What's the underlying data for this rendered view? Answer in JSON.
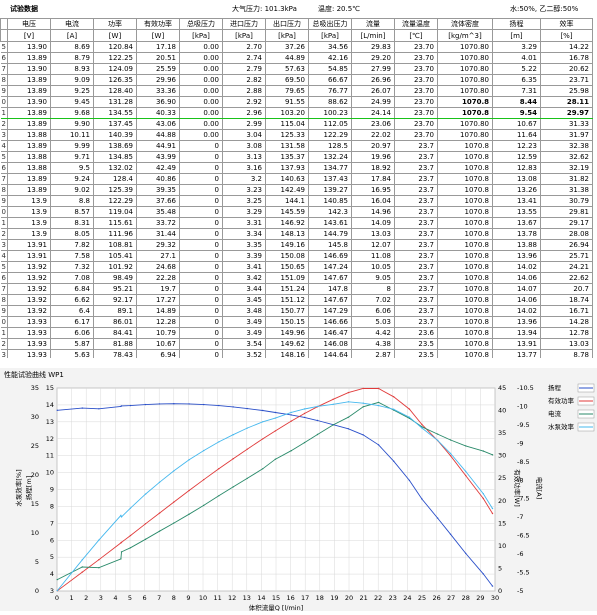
{
  "header": {
    "title": "试验数据",
    "pressure_label": "大气压力: 101.3kPa",
    "temp_label": "温度: 20.5℃",
    "right_label": "水:50%, 乙二醇:50%"
  },
  "table": {
    "headers": [
      "电压",
      "电流",
      "功率",
      "有效功率",
      "总吸压力",
      "进口压力",
      "出口压力",
      "总吸出压力",
      "流量",
      "流量温度",
      "流体密度",
      "扬程",
      "效率"
    ],
    "units": [
      "[V]",
      "[A]",
      "[W]",
      "[W]",
      "[kPa]",
      "[kPa]",
      "[kPa]",
      "[kPa]",
      "[L/min]",
      "[℃]",
      "[kg/m^3]",
      "[m]",
      "[%]"
    ],
    "index": [
      "5",
      "6",
      "7",
      "8",
      "9",
      "0",
      "1",
      "2",
      "3",
      "4",
      "5",
      "6",
      "7",
      "8",
      "9",
      "0",
      "1",
      "2",
      "3",
      "4",
      "5",
      "6",
      "7",
      "8",
      "9",
      "0",
      "1",
      "2",
      "3",
      "4",
      "5",
      "6",
      "7",
      "8",
      "9"
    ],
    "rows": [
      [
        "13.90",
        "8.69",
        "120.84",
        "17.18",
        "0.00",
        "2.70",
        "37.26",
        "34.56",
        "29.83",
        "23.70",
        "1070.80",
        "3.29",
        "14.22"
      ],
      [
        "13.89",
        "8.79",
        "122.25",
        "20.51",
        "0.00",
        "2.74",
        "44.89",
        "42.16",
        "29.20",
        "23.70",
        "1070.80",
        "4.01",
        "16.78"
      ],
      [
        "13.90",
        "8.93",
        "124.09",
        "25.59",
        "0.00",
        "2.79",
        "57.63",
        "54.85",
        "27.99",
        "23.70",
        "1070.80",
        "5.22",
        "20.62"
      ],
      [
        "13.89",
        "9.09",
        "126.35",
        "29.96",
        "0.00",
        "2.82",
        "69.50",
        "66.67",
        "26.96",
        "23.70",
        "1070.80",
        "6.35",
        "23.71"
      ],
      [
        "13.89",
        "9.25",
        "128.40",
        "33.36",
        "0.00",
        "2.88",
        "79.65",
        "76.77",
        "26.07",
        "23.70",
        "1070.80",
        "7.31",
        "25.98"
      ],
      [
        "13.90",
        "9.45",
        "131.28",
        "36.90",
        "0.00",
        "2.92",
        "91.55",
        "88.62",
        "24.99",
        "23.70",
        "1070.8",
        "8.44",
        "28.11"
      ],
      [
        "13.89",
        "9.68",
        "134.55",
        "40.33",
        "0.00",
        "2.96",
        "103.20",
        "100.23",
        "24.14",
        "23.70",
        "1070.8",
        "9.54",
        "29.97"
      ],
      [
        "13.89",
        "9.90",
        "137.45",
        "43.06",
        "0.00",
        "2.99",
        "115.04",
        "112.05",
        "23.06",
        "23.70",
        "1070.80",
        "10.67",
        "31.33"
      ],
      [
        "13.88",
        "10.11",
        "140.39",
        "44.88",
        "0.00",
        "3.04",
        "125.33",
        "122.29",
        "22.02",
        "23.70",
        "1070.80",
        "11.64",
        "31.97"
      ],
      [
        "13.89",
        "9.99",
        "138.69",
        "44.91",
        "0",
        "3.08",
        "131.58",
        "128.5",
        "20.97",
        "23.7",
        "1070.8",
        "12.23",
        "32.38"
      ],
      [
        "13.88",
        "9.71",
        "134.85",
        "43.99",
        "0",
        "3.13",
        "135.37",
        "132.24",
        "19.96",
        "23.7",
        "1070.8",
        "12.59",
        "32.62"
      ],
      [
        "13.88",
        "9.5",
        "132.02",
        "42.49",
        "0",
        "3.16",
        "137.93",
        "134.77",
        "18.92",
        "23.7",
        "1070.8",
        "12.83",
        "32.19"
      ],
      [
        "13.89",
        "9.24",
        "128.4",
        "40.86",
        "0",
        "3.2",
        "140.63",
        "137.43",
        "17.84",
        "23.7",
        "1070.8",
        "13.08",
        "31.82"
      ],
      [
        "13.89",
        "9.02",
        "125.39",
        "39.35",
        "0",
        "3.23",
        "142.49",
        "139.27",
        "16.95",
        "23.7",
        "1070.8",
        "13.26",
        "31.38"
      ],
      [
        "13.9",
        "8.8",
        "122.29",
        "37.66",
        "0",
        "3.25",
        "144.1",
        "140.85",
        "16.04",
        "23.7",
        "1070.8",
        "13.41",
        "30.79"
      ],
      [
        "13.9",
        "8.57",
        "119.04",
        "35.48",
        "0",
        "3.29",
        "145.59",
        "142.3",
        "14.96",
        "23.7",
        "1070.8",
        "13.55",
        "29.81"
      ],
      [
        "13.9",
        "8.31",
        "115.61",
        "33.72",
        "0",
        "3.31",
        "146.92",
        "143.61",
        "14.09",
        "23.7",
        "1070.8",
        "13.67",
        "29.17"
      ],
      [
        "13.9",
        "8.05",
        "111.96",
        "31.44",
        "0",
        "3.34",
        "148.13",
        "144.79",
        "13.03",
        "23.7",
        "1070.8",
        "13.78",
        "28.08"
      ],
      [
        "13.91",
        "7.82",
        "108.81",
        "29.32",
        "0",
        "3.35",
        "149.16",
        "145.8",
        "12.07",
        "23.7",
        "1070.8",
        "13.88",
        "26.94"
      ],
      [
        "13.91",
        "7.58",
        "105.41",
        "27.1",
        "0",
        "3.39",
        "150.08",
        "146.69",
        "11.08",
        "23.7",
        "1070.8",
        "13.96",
        "25.71"
      ],
      [
        "13.92",
        "7.32",
        "101.92",
        "24.68",
        "0",
        "3.41",
        "150.65",
        "147.24",
        "10.05",
        "23.7",
        "1070.8",
        "14.02",
        "24.21"
      ],
      [
        "13.92",
        "7.08",
        "98.49",
        "22.28",
        "0",
        "3.42",
        "151.09",
        "147.67",
        "9.05",
        "23.7",
        "1070.8",
        "14.06",
        "22.62"
      ],
      [
        "13.92",
        "6.84",
        "95.21",
        "19.7",
        "0",
        "3.44",
        "151.24",
        "147.8",
        "8",
        "23.7",
        "1070.8",
        "14.07",
        "20.7"
      ],
      [
        "13.92",
        "6.62",
        "92.17",
        "17.27",
        "0",
        "3.45",
        "151.12",
        "147.67",
        "7.02",
        "23.7",
        "1070.8",
        "14.06",
        "18.74"
      ],
      [
        "13.92",
        "6.4",
        "89.1",
        "14.89",
        "0",
        "3.48",
        "150.77",
        "147.29",
        "6.06",
        "23.7",
        "1070.8",
        "14.02",
        "16.71"
      ],
      [
        "13.93",
        "6.17",
        "86.01",
        "12.28",
        "0",
        "3.49",
        "150.15",
        "146.66",
        "5.03",
        "23.7",
        "1070.8",
        "13.96",
        "14.28"
      ],
      [
        "13.93",
        "6.06",
        "84.41",
        "10.79",
        "0",
        "3.49",
        "149.96",
        "146.47",
        "4.42",
        "23.6",
        "1070.8",
        "13.94",
        "12.78"
      ],
      [
        "13.93",
        "5.87",
        "81.88",
        "10.67",
        "0",
        "3.54",
        "149.62",
        "146.08",
        "4.38",
        "23.5",
        "1070.8",
        "13.91",
        "13.03"
      ],
      [
        "13.93",
        "5.63",
        "78.43",
        "6.94",
        "0",
        "3.52",
        "148.16",
        "144.64",
        "2.87",
        "23.5",
        "1070.8",
        "13.77",
        "8.78"
      ],
      [
        "13.93",
        "5.65",
        "78.71",
        "4.18",
        "0",
        "3.55",
        "148.6",
        "145.05",
        "1.73",
        "23.41",
        "1070.8",
        "13.81",
        "5.38"
      ],
      [
        "13.94",
        "5.31",
        "74.05",
        "0.05",
        "0",
        "3.54",
        "147.26",
        "143.72",
        "0.02",
        "23.4",
        "1070.8",
        "13.68",
        "0.07"
      ]
    ]
  },
  "chart": {
    "window_title": "性能试验曲线 WP1",
    "xlabel": "体积流量Q [l/min]",
    "y1label": "水泵效率[%]",
    "y2label": "扬程[m]",
    "y3label": "有效功率[W]",
    "y4label": "电流[A]",
    "legend": [
      "扬程",
      "有效功率",
      "电流",
      "水泵效率"
    ],
    "colors": [
      "#2a4fc9",
      "#e03a3a",
      "#2a8a6a",
      "#46b8ee"
    ]
  },
  "chart_data": {
    "type": "line",
    "xlabel": "体积流量Q [l/min]",
    "xlim": [
      0,
      30
    ],
    "x_ticks": [
      0,
      1,
      2,
      3,
      4,
      5,
      6,
      7,
      8,
      9,
      10,
      11,
      12,
      13,
      14,
      15,
      16,
      17,
      18,
      19,
      20,
      21,
      22,
      23,
      24,
      25,
      26,
      27,
      28,
      29,
      30
    ],
    "axes": {
      "left_outer": {
        "label": "水泵效率[%]",
        "ticks": [
          0,
          5,
          10,
          15,
          20,
          25,
          30,
          35
        ]
      },
      "left_inner": {
        "label": "扬程[m]",
        "ticks": [
          3,
          4,
          5,
          6,
          7,
          8,
          9,
          10,
          11,
          12,
          13,
          14,
          15
        ]
      },
      "right_inner": {
        "label": "有效功率[W]",
        "ticks": [
          0,
          5,
          10,
          15,
          20,
          25,
          30,
          35,
          40,
          45
        ]
      },
      "right_outer": {
        "label": "电流[A]",
        "ticks": [
          -5,
          -5.5,
          -6,
          -6.5,
          -7,
          -7.5,
          -8,
          -8.5,
          -9,
          -9.5,
          -10,
          -10.5
        ]
      }
    },
    "series": [
      {
        "name": "扬程",
        "axis": "left_inner",
        "x": [
          0.02,
          1.73,
          2.87,
          4.38,
          4.42,
          5.03,
          6.06,
          7.02,
          8,
          9.05,
          10.05,
          11.08,
          12.07,
          13.03,
          14.09,
          14.96,
          16.04,
          16.95,
          17.84,
          18.92,
          19.96,
          20.97,
          22.02,
          23.06,
          24.14,
          24.99,
          26.07,
          26.96,
          27.99,
          29.2,
          29.83
        ],
        "y": [
          13.68,
          13.81,
          13.77,
          13.91,
          13.94,
          13.96,
          14.02,
          14.06,
          14.07,
          14.06,
          14.02,
          13.96,
          13.88,
          13.78,
          13.67,
          13.55,
          13.41,
          13.26,
          13.08,
          12.83,
          12.59,
          12.23,
          11.64,
          10.67,
          9.54,
          8.44,
          7.31,
          6.35,
          5.22,
          4.01,
          3.29
        ]
      },
      {
        "name": "有效功率",
        "axis": "right_inner",
        "x": [
          0.02,
          1.73,
          2.87,
          4.38,
          4.42,
          5.03,
          6.06,
          7.02,
          8,
          9.05,
          10.05,
          11.08,
          12.07,
          13.03,
          14.09,
          14.96,
          16.04,
          16.95,
          17.84,
          18.92,
          19.96,
          20.97,
          22.02,
          23.06,
          24.14,
          24.99,
          26.07,
          26.96,
          27.99,
          29.2,
          29.83
        ],
        "y": [
          0.05,
          4.18,
          6.94,
          10.67,
          10.79,
          12.28,
          14.89,
          17.27,
          19.7,
          22.28,
          24.68,
          27.1,
          29.32,
          31.44,
          33.72,
          35.48,
          37.66,
          39.35,
          40.86,
          42.49,
          43.99,
          44.91,
          44.88,
          43.06,
          40.33,
          36.9,
          33.36,
          29.96,
          25.59,
          20.51,
          17.18
        ]
      },
      {
        "name": "电流",
        "axis": "right_outer",
        "x": [
          0.02,
          1.73,
          2.87,
          4.38,
          4.42,
          5.03,
          6.06,
          7.02,
          8,
          9.05,
          10.05,
          11.08,
          12.07,
          13.03,
          14.09,
          14.96,
          16.04,
          16.95,
          17.84,
          18.92,
          19.96,
          20.97,
          22.02,
          23.06,
          24.14,
          24.99,
          26.07,
          26.96,
          27.99,
          29.2,
          29.83
        ],
        "y": [
          5.31,
          5.65,
          5.63,
          5.87,
          6.06,
          6.17,
          6.4,
          6.62,
          6.84,
          7.08,
          7.32,
          7.58,
          7.82,
          8.05,
          8.31,
          8.57,
          8.8,
          9.02,
          9.24,
          9.5,
          9.71,
          9.99,
          10.11,
          9.9,
          9.68,
          9.45,
          9.25,
          9.09,
          8.93,
          8.79,
          8.69
        ]
      },
      {
        "name": "水泵效率",
        "axis": "left_outer",
        "x": [
          0.02,
          1.73,
          2.87,
          4.38,
          4.42,
          5.03,
          6.06,
          7.02,
          8,
          9.05,
          10.05,
          11.08,
          12.07,
          13.03,
          14.09,
          14.96,
          16.04,
          16.95,
          17.84,
          18.92,
          19.96,
          20.97,
          22.02,
          23.06,
          24.14,
          24.99,
          26.07,
          26.96,
          27.99,
          29.2,
          29.83
        ],
        "y": [
          0.07,
          5.38,
          8.78,
          13.03,
          12.78,
          14.28,
          16.71,
          18.74,
          20.7,
          22.62,
          24.21,
          25.71,
          26.94,
          28.08,
          29.17,
          29.81,
          30.79,
          31.38,
          31.82,
          32.19,
          32.62,
          32.38,
          31.97,
          31.33,
          29.97,
          28.11,
          25.98,
          23.71,
          20.62,
          16.78,
          14.22
        ]
      }
    ],
    "legend_position": "right"
  }
}
